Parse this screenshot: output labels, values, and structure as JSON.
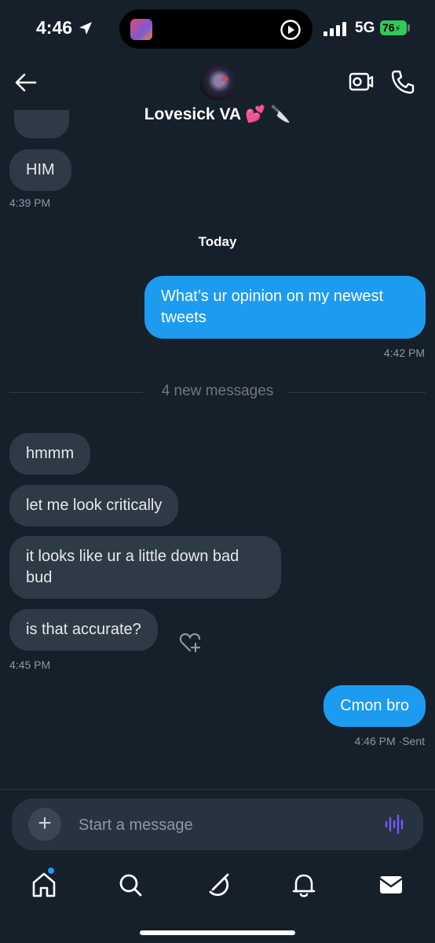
{
  "status_bar": {
    "time": "4:46",
    "network": "5G",
    "battery": "76"
  },
  "header": {
    "name": "Lovesick VA",
    "emoji": "💕 🔪",
    "back_icon": "arrow-left-icon",
    "video_icon": "video-camera-icon",
    "call_icon": "phone-icon"
  },
  "conversation": {
    "earlier": {
      "text": "HIM",
      "time": "4:39 PM"
    },
    "day_separator": "Today",
    "sent_1": {
      "text": "What’s ur opinion on my newest tweets",
      "time": "4:42 PM"
    },
    "new_messages_label": "4 new messages",
    "received": [
      "hmmm",
      "let me look critically",
      "it looks like ur a little down bad bud",
      "is that accurate?"
    ],
    "received_time": "4:45 PM",
    "sent_2": {
      "text": "Cmon bro",
      "time": "4:46 PM",
      "status": "·Sent"
    }
  },
  "composer": {
    "placeholder": "Start a message",
    "add_icon": "plus-icon",
    "voice_icon": "voice-waveform-icon"
  },
  "tab_bar": {
    "items": [
      "home-icon",
      "search-icon",
      "grok-icon",
      "bell-icon",
      "mail-icon"
    ],
    "active": "mail-icon"
  },
  "colors": {
    "background": "#15202b",
    "sent_bubble": "#1d9bf0",
    "received_bubble": "#2f3a47",
    "battery": "#34c759"
  }
}
